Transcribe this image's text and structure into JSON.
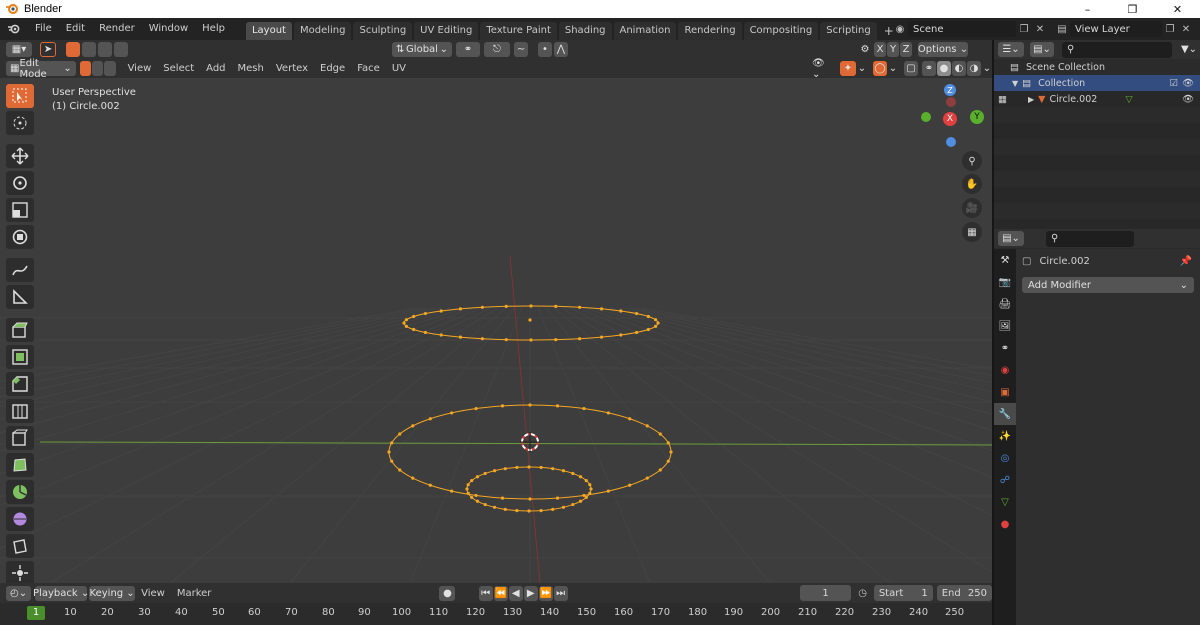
{
  "window": {
    "title": "Blender"
  },
  "menu": [
    "File",
    "Edit",
    "Render",
    "Window",
    "Help"
  ],
  "workspaces": [
    "Layout",
    "Modeling",
    "Sculpting",
    "UV Editing",
    "Texture Paint",
    "Shading",
    "Animation",
    "Rendering",
    "Compositing",
    "Scripting"
  ],
  "active_workspace": "Layout",
  "scene": {
    "name": "Scene",
    "view_layer": "View Layer"
  },
  "viewport_header": {
    "orientation": "Global",
    "options_label": "Options",
    "axes": [
      "X",
      "Y",
      "Z"
    ],
    "mode": "Edit Mode",
    "menus": [
      "View",
      "Select",
      "Add",
      "Mesh",
      "Vertex",
      "Edge",
      "Face",
      "UV"
    ]
  },
  "viewport": {
    "perspective": "User Perspective",
    "object_label": "(1) Circle.002",
    "gizmo_axes": [
      "Z",
      "X",
      "Y"
    ]
  },
  "timeline": {
    "menus": [
      "Playback",
      "Keying",
      "View",
      "Marker"
    ],
    "current_frame": "1",
    "start_label": "Start",
    "start": "1",
    "end_label": "End",
    "end": "250",
    "ruler": [
      "1",
      "10",
      "20",
      "30",
      "40",
      "50",
      "60",
      "70",
      "80",
      "90",
      "100",
      "110",
      "120",
      "130",
      "140",
      "150",
      "160",
      "170",
      "180",
      "190",
      "200",
      "210",
      "220",
      "230",
      "240",
      "250"
    ]
  },
  "outliner": {
    "rows": [
      {
        "label": "Scene Collection"
      },
      {
        "label": "Collection"
      },
      {
        "label": "Circle.002"
      }
    ]
  },
  "properties": {
    "object_name": "Circle.002",
    "add_modifier": "Add Modifier"
  },
  "colors": {
    "accent_orange": "#e06a35",
    "selected_blue": "#4772b3",
    "vertex_color": "#f5a623",
    "axis_x": "#e04040",
    "axis_y": "#5ab02c",
    "axis_z": "#4f8ee0"
  }
}
